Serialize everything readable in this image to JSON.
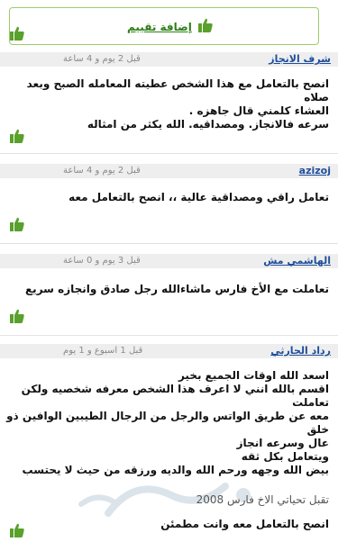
{
  "header": {
    "add_rating_label": "إضافة تقييم"
  },
  "reviews": [
    {
      "author": "شرف الانجاز",
      "time": "قبل 2 يوم و 4 ساعة",
      "lines": [
        "انصح بالتعامل مع هذا الشخص عطيته المعامله الصبح وبعد صلاه",
        "العشاء كلمني قال جاهزه .",
        "سرعه فالانجاز. ومصداقيه. الله يكثر من امثاله"
      ]
    },
    {
      "author": "azizoj",
      "time": "قبل 2 يوم و 4 ساعة",
      "lines": [
        "تعامل راقي ومصداقية عالية ،، انصح بالتعامل معه"
      ]
    },
    {
      "author": "الهاشمي مش",
      "time": "قبل 3 يوم و 0 ساعة",
      "lines": [
        "تعاملت مع الأخ فارس ماشاءالله رجل صادق وانجازه سريع"
      ]
    },
    {
      "author": "رداد الحارثي",
      "time": "قبل 1 اسبوع و 1 يوم",
      "lines": [
        "اسعد الله اوقات الجميع بخير",
        "اقسم بالله انني لا اعرف هذا الشخص معرفه شخصيه ولكن تعاملت",
        "معه عن طريق الواتس والرجل من الرجال الطيبين الوافين ذو خلق",
        "عال وسرعه انجاز",
        "ويتعامل بكل ثقه",
        "بيض الله وجهه ورحم الله والديه ورزقه من حيث لا يحتسب"
      ]
    }
  ],
  "reply": {
    "label": "تقبل تحياتي الاخ فارس 2008",
    "body": "انصح بالتعامل معه وانت مطمئن"
  },
  "colors": {
    "thumb_green": "#5aa02c",
    "author_blue": "#1f4e9c",
    "frame_green": "#9ccc6a"
  }
}
